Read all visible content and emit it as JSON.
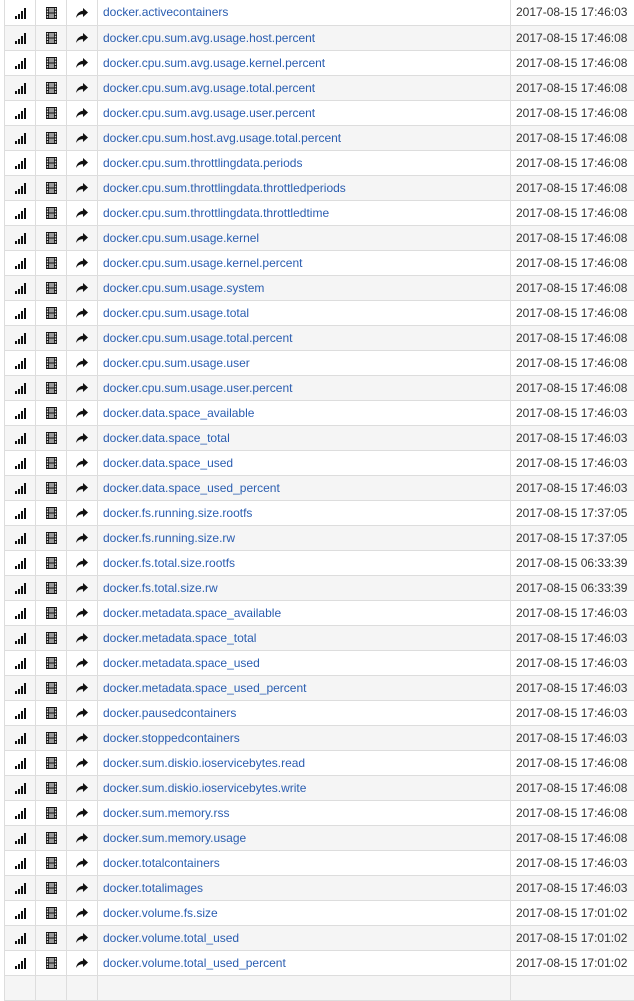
{
  "icons": {
    "graph": "bar-chart-icon",
    "film": "film-icon",
    "share": "share-arrow-icon"
  },
  "colors": {
    "link": "#2a5db0",
    "border": "#dddddd",
    "stripe": "#f5f5f5"
  },
  "metrics": [
    {
      "name": "docker.activecontainers",
      "updated": "2017-08-15 17:46:03"
    },
    {
      "name": "docker.cpu.sum.avg.usage.host.percent",
      "updated": "2017-08-15 17:46:08"
    },
    {
      "name": "docker.cpu.sum.avg.usage.kernel.percent",
      "updated": "2017-08-15 17:46:08"
    },
    {
      "name": "docker.cpu.sum.avg.usage.total.percent",
      "updated": "2017-08-15 17:46:08"
    },
    {
      "name": "docker.cpu.sum.avg.usage.user.percent",
      "updated": "2017-08-15 17:46:08"
    },
    {
      "name": "docker.cpu.sum.host.avg.usage.total.percent",
      "updated": "2017-08-15 17:46:08"
    },
    {
      "name": "docker.cpu.sum.throttlingdata.periods",
      "updated": "2017-08-15 17:46:08"
    },
    {
      "name": "docker.cpu.sum.throttlingdata.throttledperiods",
      "updated": "2017-08-15 17:46:08"
    },
    {
      "name": "docker.cpu.sum.throttlingdata.throttledtime",
      "updated": "2017-08-15 17:46:08"
    },
    {
      "name": "docker.cpu.sum.usage.kernel",
      "updated": "2017-08-15 17:46:08"
    },
    {
      "name": "docker.cpu.sum.usage.kernel.percent",
      "updated": "2017-08-15 17:46:08"
    },
    {
      "name": "docker.cpu.sum.usage.system",
      "updated": "2017-08-15 17:46:08"
    },
    {
      "name": "docker.cpu.sum.usage.total",
      "updated": "2017-08-15 17:46:08"
    },
    {
      "name": "docker.cpu.sum.usage.total.percent",
      "updated": "2017-08-15 17:46:08"
    },
    {
      "name": "docker.cpu.sum.usage.user",
      "updated": "2017-08-15 17:46:08"
    },
    {
      "name": "docker.cpu.sum.usage.user.percent",
      "updated": "2017-08-15 17:46:08"
    },
    {
      "name": "docker.data.space_available",
      "updated": "2017-08-15 17:46:03"
    },
    {
      "name": "docker.data.space_total",
      "updated": "2017-08-15 17:46:03"
    },
    {
      "name": "docker.data.space_used",
      "updated": "2017-08-15 17:46:03"
    },
    {
      "name": "docker.data.space_used_percent",
      "updated": "2017-08-15 17:46:03"
    },
    {
      "name": "docker.fs.running.size.rootfs",
      "updated": "2017-08-15 17:37:05"
    },
    {
      "name": "docker.fs.running.size.rw",
      "updated": "2017-08-15 17:37:05"
    },
    {
      "name": "docker.fs.total.size.rootfs",
      "updated": "2017-08-15 06:33:39"
    },
    {
      "name": "docker.fs.total.size.rw",
      "updated": "2017-08-15 06:33:39"
    },
    {
      "name": "docker.metadata.space_available",
      "updated": "2017-08-15 17:46:03"
    },
    {
      "name": "docker.metadata.space_total",
      "updated": "2017-08-15 17:46:03"
    },
    {
      "name": "docker.metadata.space_used",
      "updated": "2017-08-15 17:46:03"
    },
    {
      "name": "docker.metadata.space_used_percent",
      "updated": "2017-08-15 17:46:03"
    },
    {
      "name": "docker.pausedcontainers",
      "updated": "2017-08-15 17:46:03"
    },
    {
      "name": "docker.stoppedcontainers",
      "updated": "2017-08-15 17:46:03"
    },
    {
      "name": "docker.sum.diskio.ioservicebytes.read",
      "updated": "2017-08-15 17:46:08"
    },
    {
      "name": "docker.sum.diskio.ioservicebytes.write",
      "updated": "2017-08-15 17:46:08"
    },
    {
      "name": "docker.sum.memory.rss",
      "updated": "2017-08-15 17:46:08"
    },
    {
      "name": "docker.sum.memory.usage",
      "updated": "2017-08-15 17:46:08"
    },
    {
      "name": "docker.totalcontainers",
      "updated": "2017-08-15 17:46:03"
    },
    {
      "name": "docker.totalimages",
      "updated": "2017-08-15 17:46:03"
    },
    {
      "name": "docker.volume.fs.size",
      "updated": "2017-08-15 17:01:02"
    },
    {
      "name": "docker.volume.total_used",
      "updated": "2017-08-15 17:01:02"
    },
    {
      "name": "docker.volume.total_used_percent",
      "updated": "2017-08-15 17:01:02"
    },
    {
      "name": "",
      "updated": ""
    }
  ]
}
